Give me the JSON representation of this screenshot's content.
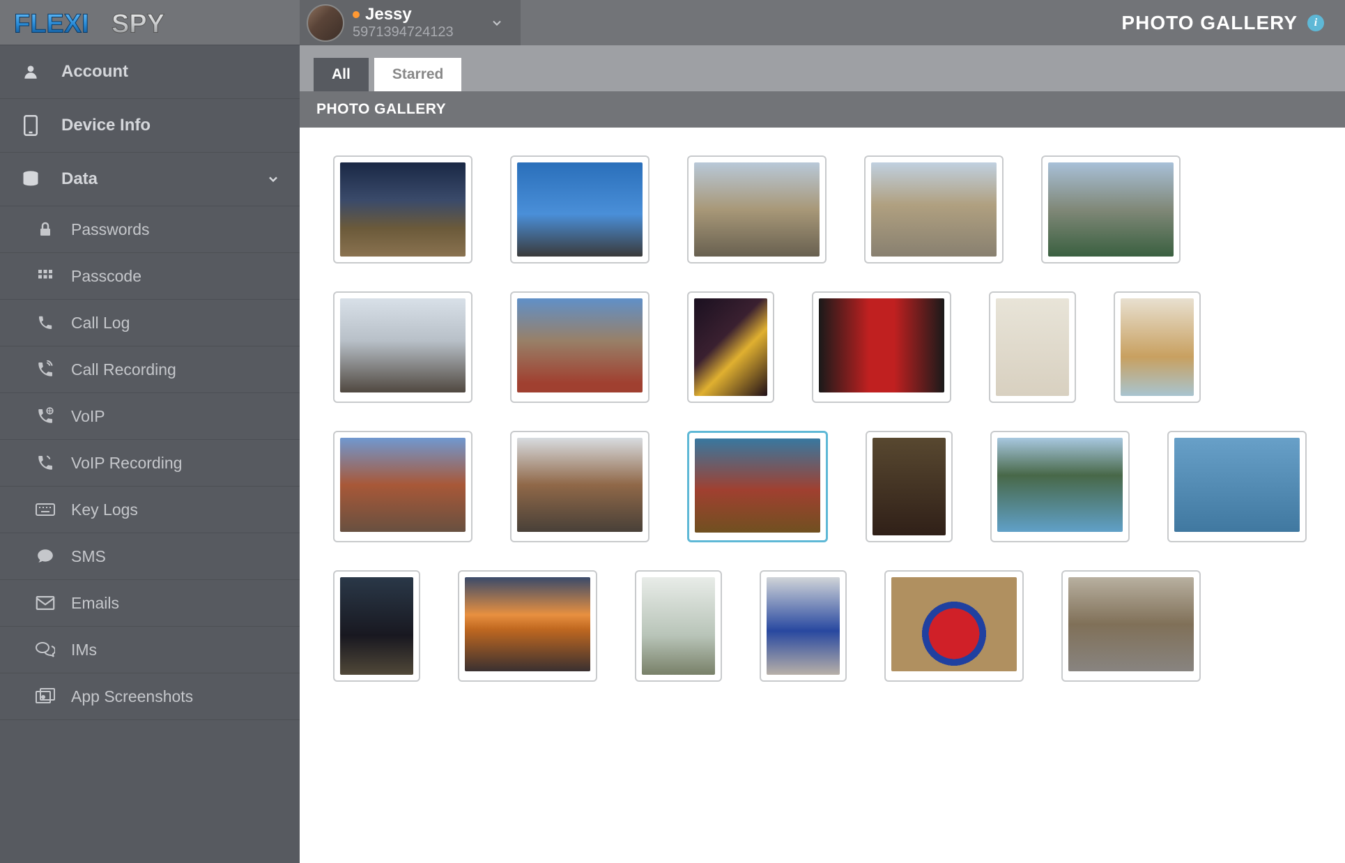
{
  "brand": {
    "name": "FLEXISPY"
  },
  "user": {
    "name": "Jessy",
    "id": "5971394724123",
    "status_color": "#ff9933"
  },
  "header": {
    "title": "PHOTO GALLERY"
  },
  "tabs": {
    "all": "All",
    "starred": "Starred",
    "active": "all"
  },
  "section": {
    "title": "PHOTO GALLERY"
  },
  "sidebar": {
    "account": "Account",
    "device_info": "Device Info",
    "data": "Data",
    "sub": {
      "passwords": "Passwords",
      "passcode": "Passcode",
      "call_log": "Call Log",
      "call_recording": "Call Recording",
      "voip": "VoIP",
      "voip_recording": "VoIP Recording",
      "key_logs": "Key Logs",
      "sms": "SMS",
      "emails": "Emails",
      "ims": "IMs",
      "app_screenshots": "App Screenshots"
    }
  },
  "gallery": {
    "rows": [
      [
        {
          "orientation": "landscape",
          "cls": "p-sunset1",
          "selected": false
        },
        {
          "orientation": "landscape",
          "cls": "p-sky1",
          "selected": false
        },
        {
          "orientation": "landscape",
          "cls": "p-street1",
          "selected": false
        },
        {
          "orientation": "landscape",
          "cls": "p-street2",
          "selected": false
        },
        {
          "orientation": "landscape",
          "cls": "p-lawn",
          "selected": false
        }
      ],
      [
        {
          "orientation": "landscape",
          "cls": "p-tree",
          "selected": false
        },
        {
          "orientation": "landscape",
          "cls": "p-building1",
          "selected": false
        },
        {
          "orientation": "portrait",
          "cls": "p-night",
          "selected": false
        },
        {
          "orientation": "landscape",
          "cls": "p-booth",
          "selected": false
        },
        {
          "orientation": "portrait",
          "cls": "p-table",
          "selected": false
        },
        {
          "orientation": "portrait",
          "cls": "p-tea",
          "selected": false
        }
      ],
      [
        {
          "orientation": "landscape",
          "cls": "p-brick",
          "selected": false
        },
        {
          "orientation": "landscape",
          "cls": "p-dept",
          "selected": false
        },
        {
          "orientation": "landscape",
          "cls": "p-fair",
          "selected": true
        },
        {
          "orientation": "portrait",
          "cls": "p-interior",
          "selected": false
        },
        {
          "orientation": "landscape",
          "cls": "p-lake",
          "selected": false
        },
        {
          "orientation": "landscape",
          "cls": "p-lake2",
          "selected": false
        }
      ],
      [
        {
          "orientation": "portrait",
          "cls": "p-night2",
          "selected": false
        },
        {
          "orientation": "landscape",
          "cls": "p-sunset2",
          "selected": false
        },
        {
          "orientation": "portrait",
          "cls": "p-palm",
          "selected": false
        },
        {
          "orientation": "portrait",
          "cls": "p-tube",
          "selected": false
        },
        {
          "orientation": "landscape",
          "cls": "p-sign",
          "selected": false
        },
        {
          "orientation": "landscape",
          "cls": "p-station",
          "selected": false
        }
      ]
    ]
  }
}
